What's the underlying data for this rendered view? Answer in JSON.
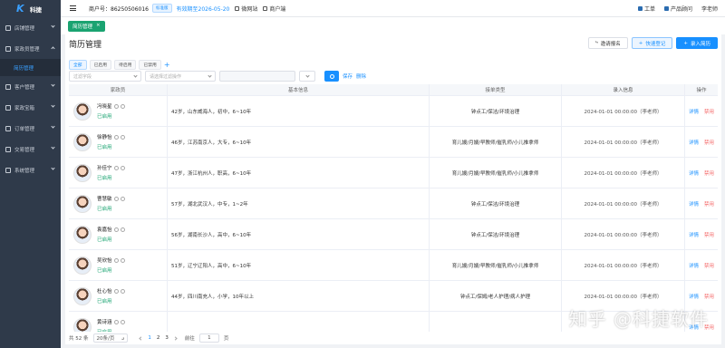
{
  "app": {
    "logo_text": "科捷"
  },
  "sidebar": {
    "items": [
      {
        "label": "店铺管理"
      },
      {
        "label": "家政员管理"
      },
      {
        "label": "客户管理"
      },
      {
        "label": "家政宝箱"
      },
      {
        "label": "订单管理"
      },
      {
        "label": "交易管理"
      },
      {
        "label": "系统管理"
      }
    ],
    "sub_active": "简历管理"
  },
  "topbar": {
    "merchant": "商户号：86250506016",
    "edition": "标准版",
    "expire": "有效期至2026-05-20",
    "nav": [
      "微网站",
      "商户端"
    ],
    "right": [
      "工单",
      "产品顾问",
      "李老师"
    ]
  },
  "tabs": {
    "active": "简历管理",
    "close": "×"
  },
  "page": {
    "title": "简历管理",
    "buttons": {
      "invite": "邀请报名",
      "quick": "快速登记",
      "add": "录入简历"
    },
    "filter_tabs": [
      "全部",
      "已启用",
      "待启用",
      "已禁用"
    ],
    "filter_add": "+",
    "filter_field_placeholder": "过滤字段",
    "filter_op_placeholder": "请选择过滤操作",
    "save": "保存",
    "delete": "删除"
  },
  "table": {
    "headers": [
      "家政员",
      "基本信息",
      "接单类型",
      "录入信息",
      "操作"
    ],
    "rows": [
      {
        "name": "冯晓星",
        "status": "已启用",
        "info": "42岁，山东威海人，初中，6~10年",
        "type": "钟点工/保洁/环境治理",
        "entry": "2024-01-01 00:00:00（李老师）"
      },
      {
        "name": "徐静怡",
        "status": "已启用",
        "info": "46岁，江苏南京人，大专，6~10年",
        "type": "育儿嫂/月嫂/早教师/催乳师/小儿推拿师",
        "entry": "2024-01-01 00:00:00（李老师）"
      },
      {
        "name": "孙佳宁",
        "status": "已启用",
        "info": "47岁，浙江杭州人，职高，6~10年",
        "type": "育儿嫂/月嫂/早教师/催乳师/小儿推拿师",
        "entry": "2024-01-01 00:00:00（李老师）"
      },
      {
        "name": "曹慧敏",
        "status": "已启用",
        "info": "57岁，湖北武汉人，中专，1~2年",
        "type": "钟点工/保洁/环境治理",
        "entry": "2024-01-01 00:00:00（李老师）"
      },
      {
        "name": "袁嘉怡",
        "status": "已启用",
        "info": "56岁，湖南长沙人，高中，6~10年",
        "type": "钟点工/保洁/环境治理",
        "entry": "2024-01-01 00:00:00（李老师）"
      },
      {
        "name": "吴欣怡",
        "status": "已启用",
        "info": "51岁，辽宁辽阳人，高中，6~10年",
        "type": "育儿嫂/月嫂/早教师/催乳师/小儿推拿师",
        "entry": "2024-01-01 00:00:00（李老师）"
      },
      {
        "name": "杜心怡",
        "status": "已启用",
        "info": "44岁，四川南充人，小学，10年以上",
        "type": "钟点工/保姆/老人护理/病人护理",
        "entry": "2024-01-01 00:00:00（李老师）"
      },
      {
        "name": "黄诗涵",
        "status": "已启用",
        "info": "",
        "type": "",
        "entry": ""
      }
    ],
    "op_detail": "详情",
    "op_disable": "禁用"
  },
  "footer": {
    "total": "共 52 条",
    "page_size": "20条/页",
    "pages": [
      "1",
      "2",
      "3"
    ],
    "goto_label": "前往",
    "goto_value": "1",
    "goto_suffix": "页"
  },
  "watermark": "知乎 @科捷软件"
}
